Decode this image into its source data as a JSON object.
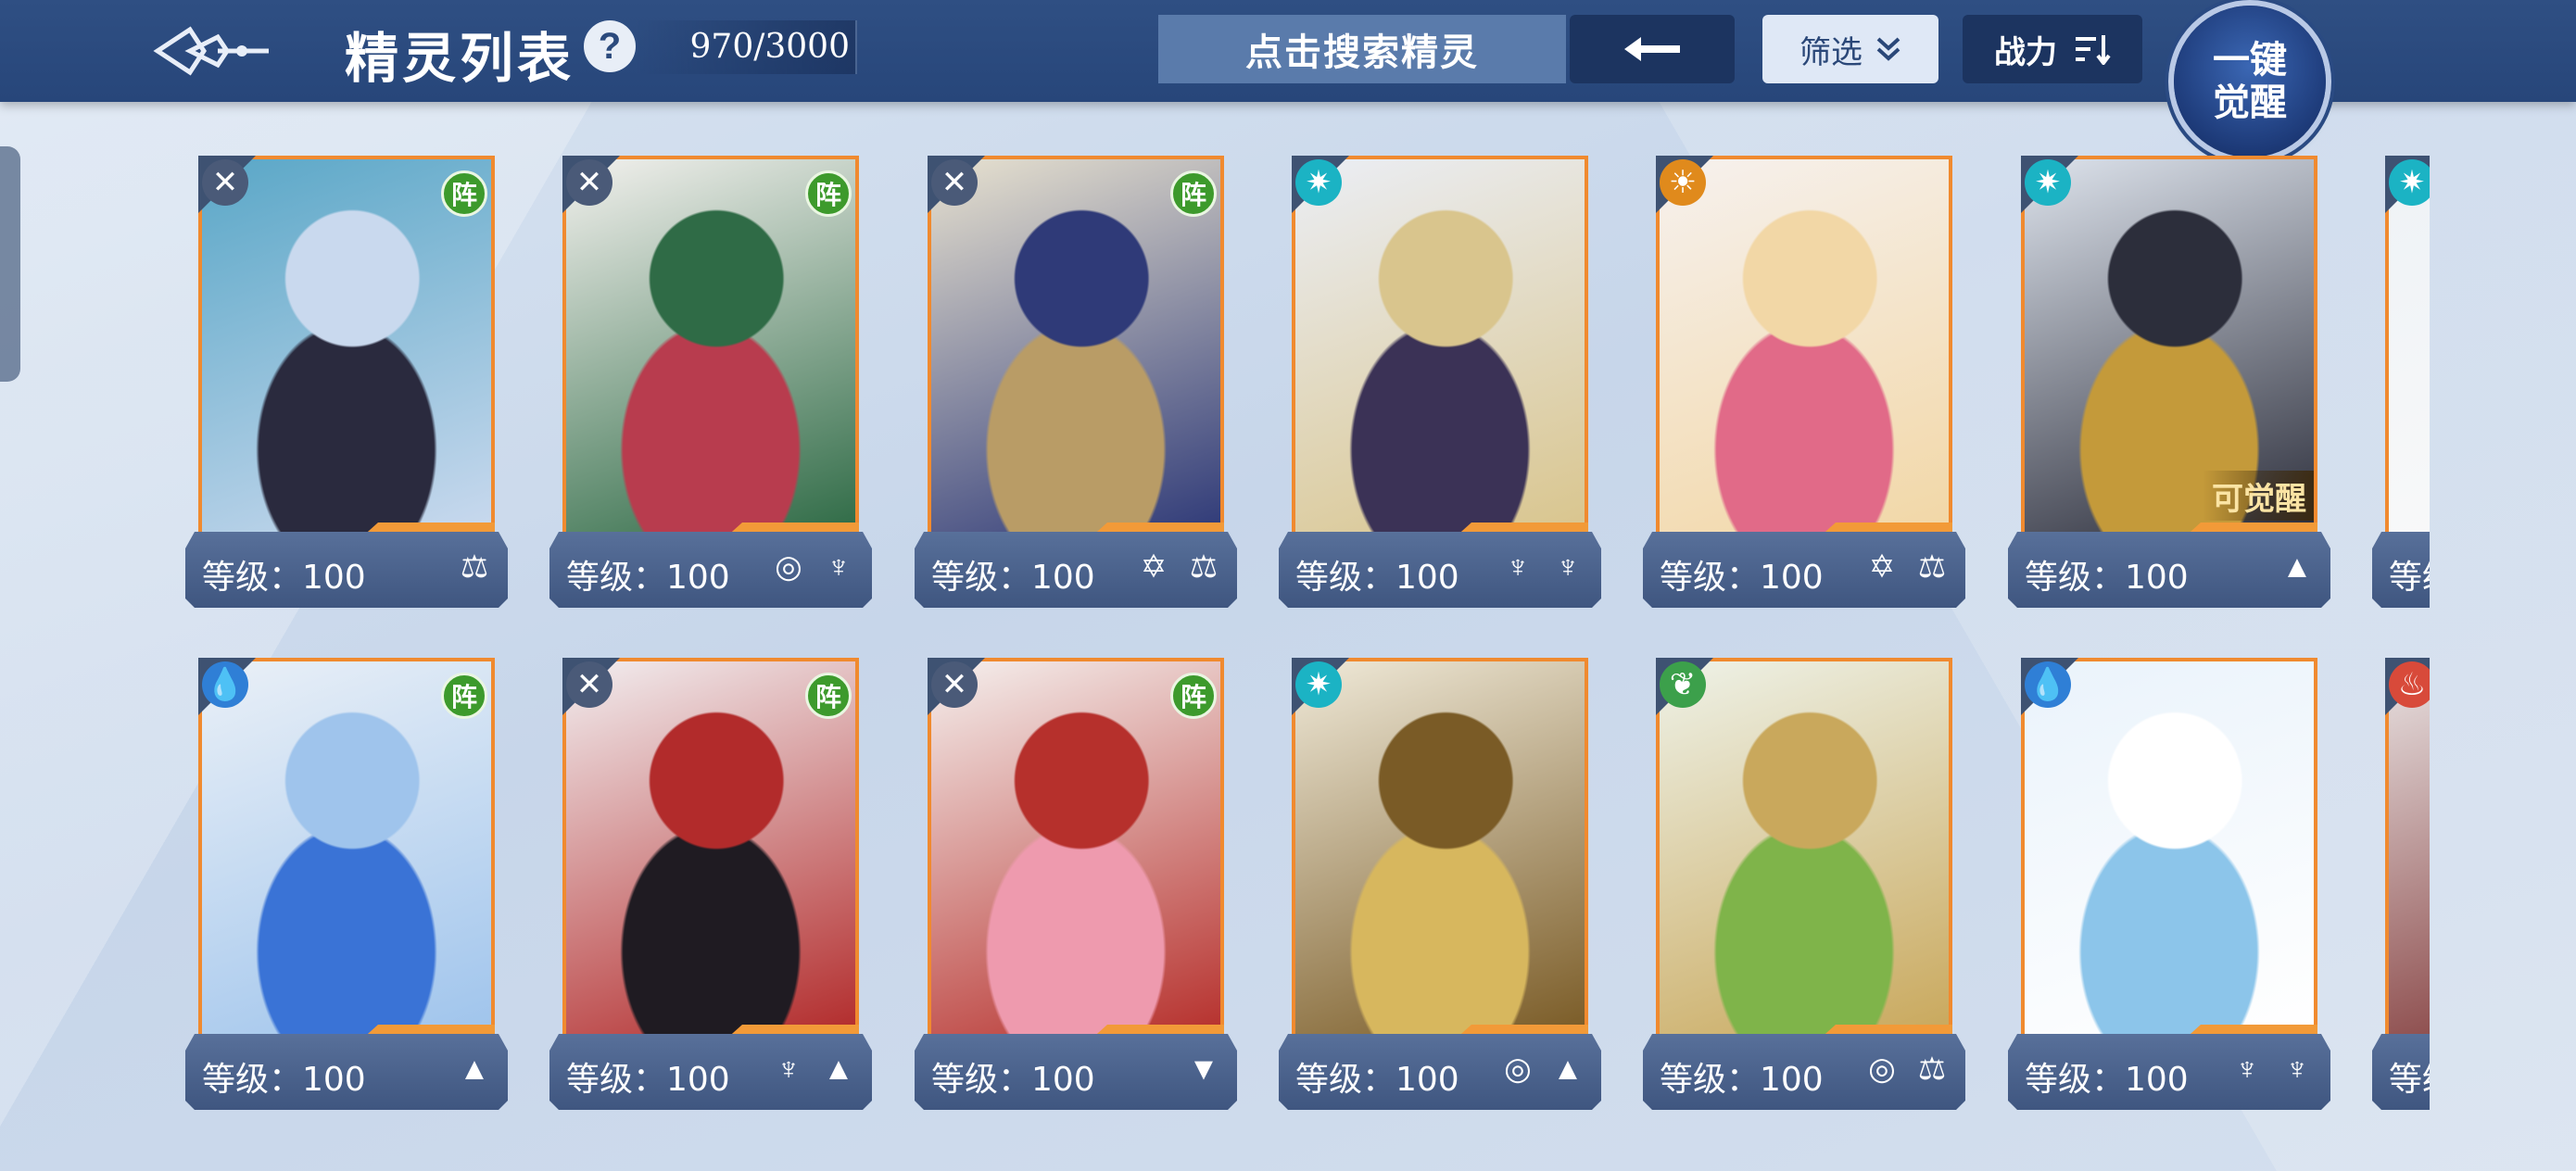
{
  "header": {
    "title": "精灵列表",
    "help_label": "?",
    "count": "970/3000",
    "search_label": "点击搜索精灵",
    "back_icon": "←",
    "filter_label": "筛选",
    "filter_icon": "»",
    "power_label": "战力",
    "power_icon": "⇅",
    "awaken_line1": "一键",
    "awaken_line2": "觉醒"
  },
  "row1": [
    {
      "level": "等级：100",
      "element": "none",
      "element_icon": "✕",
      "badge": "阵",
      "traits": [
        "⚖"
      ]
    },
    {
      "level": "等级：100",
      "element": "none",
      "element_icon": "✕",
      "badge": "阵",
      "traits": [
        "◎",
        "♆"
      ]
    },
    {
      "level": "等级：100",
      "element": "none",
      "element_icon": "✕",
      "badge": "阵",
      "traits": [
        "✡",
        "⚖"
      ]
    },
    {
      "level": "等级：100",
      "element": "star",
      "element_icon": "✷",
      "badge": "",
      "traits": [
        "♆",
        "♆"
      ]
    },
    {
      "level": "等级：100",
      "element": "sun",
      "element_icon": "☀",
      "badge": "",
      "traits": [
        "✡",
        "⚖"
      ]
    },
    {
      "level": "等级：100",
      "element": "star",
      "element_icon": "✷",
      "badge": "",
      "awake_tag": "可觉醒",
      "traits": [
        "▲"
      ]
    },
    {
      "level": "等级",
      "element": "star",
      "element_icon": "✷",
      "badge": "",
      "traits": []
    }
  ],
  "row2": [
    {
      "level": "等级：100",
      "element": "water",
      "element_icon": "💧",
      "badge": "阵",
      "traits": [
        "▲"
      ]
    },
    {
      "level": "等级：100",
      "element": "none",
      "element_icon": "✕",
      "badge": "阵",
      "traits": [
        "♆",
        "▲"
      ]
    },
    {
      "level": "等级：100",
      "element": "none",
      "element_icon": "✕",
      "badge": "阵",
      "traits": [
        "▼"
      ]
    },
    {
      "level": "等级：100",
      "element": "star",
      "element_icon": "✷",
      "badge": "",
      "traits": [
        "◎",
        "▲"
      ]
    },
    {
      "level": "等级：100",
      "element": "leaf",
      "element_icon": "❦",
      "badge": "",
      "traits": [
        "◎",
        "⚖"
      ]
    },
    {
      "level": "等级：100",
      "element": "water",
      "element_icon": "💧",
      "badge": "",
      "traits": [
        "♆",
        "♆"
      ]
    },
    {
      "level": "等级",
      "element": "fire",
      "element_icon": "♨",
      "badge": "",
      "traits": []
    }
  ],
  "colors": {
    "topbar": "#2f4f83",
    "card_border": "#f08a2f",
    "plate": "#4a628d",
    "badge_green": "#3d9a2c"
  },
  "art": {
    "row1": [
      [
        "#5aa7c7",
        "#2a2a3e",
        "#c9d9ee"
      ],
      [
        "#f3f1ee",
        "#b83c4e",
        "#2f6b46"
      ],
      [
        "#e8e2d0",
        "#b99c66",
        "#2f3a78"
      ],
      [
        "#ebeef5",
        "#3b3256",
        "#d9c58d"
      ],
      [
        "#f6f1ee",
        "#e16a88",
        "#f2d7a6"
      ],
      [
        "#dde3ec",
        "#c49a3a",
        "#2c2e3b"
      ],
      [
        "#eef2f6",
        "#c9c2a4",
        "#fafafa"
      ]
    ],
    "row2": [
      [
        "#eaf0f7",
        "#3a73d6",
        "#9fc4ec"
      ],
      [
        "#f2eef0",
        "#1f1b22",
        "#b22b2b"
      ],
      [
        "#f5f0ee",
        "#ee9aae",
        "#b6302c"
      ],
      [
        "#efe9d8",
        "#d7b75e",
        "#7a5b26"
      ],
      [
        "#eef2e8",
        "#7fb44a",
        "#c9a85c"
      ],
      [
        "#eaf3fb",
        "#8cc5ea",
        "#ffffff"
      ],
      [
        "#e9e3e3",
        "#4a2b2b",
        "#7b2f2f"
      ]
    ]
  }
}
